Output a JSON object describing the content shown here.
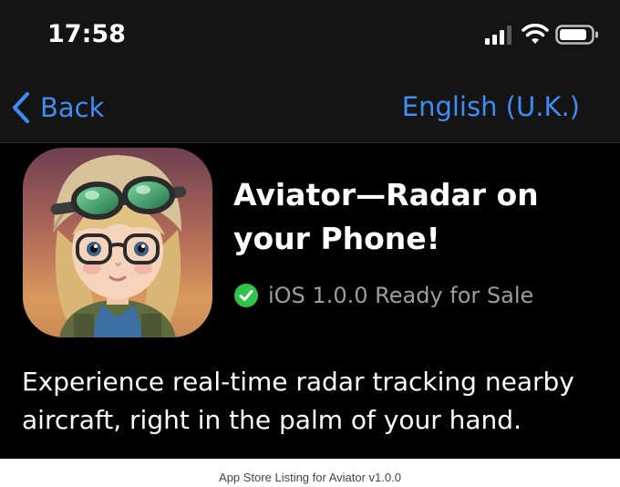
{
  "status_bar": {
    "time": "17:58",
    "icons": [
      "cellular-signal-icon",
      "wifi-icon",
      "battery-icon"
    ]
  },
  "nav": {
    "back_label": "Back",
    "language": "English (U.K.)"
  },
  "app": {
    "name": "Aviator—Radar on your Phone!",
    "status": "iOS 1.0.0 Ready for Sale",
    "description": "Experience real-time radar tracking nearby aircraft, right in the palm of your hand."
  },
  "caption": "App Store Listing for Aviator v1.0.0",
  "colors": {
    "accent": "#3e8df3",
    "status_green": "#30c34a",
    "background": "#000000",
    "bar_background": "#141414"
  }
}
